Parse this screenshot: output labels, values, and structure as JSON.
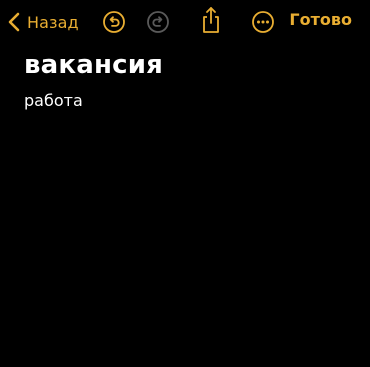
{
  "toolbar": {
    "back_label": "Назад",
    "done_label": "Готово",
    "icons": {
      "back": "chevron-left-icon",
      "undo": "undo-icon",
      "redo": "redo-icon",
      "share": "share-icon",
      "more": "more-icon"
    },
    "undo_enabled": true,
    "redo_enabled": false
  },
  "note": {
    "title": "вакансия",
    "body": "работа"
  },
  "colors": {
    "accent": "#E9AE32",
    "disabled": "#5a5a5a",
    "background": "#000000",
    "text": "#ffffff"
  }
}
